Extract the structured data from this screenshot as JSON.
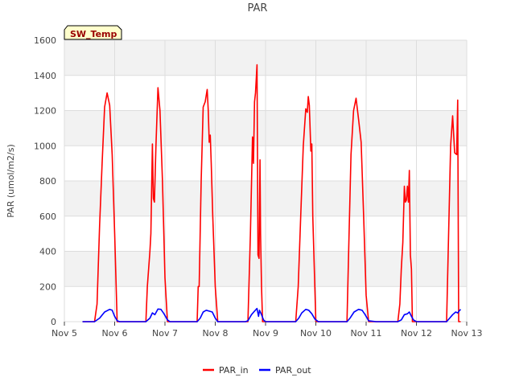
{
  "chart_data": {
    "type": "line",
    "title": "PAR",
    "xlabel": "",
    "ylabel": "PAR (umol/m2/s)",
    "badge": "SW_Temp",
    "xlim": [
      5,
      13
    ],
    "ylim": [
      0,
      1600
    ],
    "x_ticks": [
      5,
      6,
      7,
      8,
      9,
      10,
      11,
      12,
      13
    ],
    "x_tick_labels": [
      "Nov 5",
      "Nov 6",
      "Nov 7",
      "Nov 8",
      "Nov 9",
      "Nov 10",
      "Nov 11",
      "Nov 12",
      "Nov 13"
    ],
    "y_ticks": [
      0,
      200,
      400,
      600,
      800,
      1000,
      1200,
      1400,
      1600
    ],
    "y_tick_labels": [
      "0",
      "200",
      "400",
      "600",
      "800",
      "1000",
      "1200",
      "1400",
      "1600"
    ],
    "grid": true,
    "legend_position": "bottom-center",
    "series": [
      {
        "name": "PAR_in",
        "color": "#ff0000",
        "x": [
          5.36,
          5.6,
          5.65,
          5.7,
          5.75,
          5.8,
          5.85,
          5.9,
          5.95,
          6.0,
          6.05,
          6.1,
          6.15,
          6.2,
          6.25,
          6.35,
          6.62,
          6.65,
          6.7,
          6.72,
          6.75,
          6.77,
          6.79,
          6.82,
          6.86,
          6.9,
          6.95,
          7.0,
          7.05,
          7.1,
          7.15,
          7.25,
          7.64,
          7.66,
          7.68,
          7.72,
          7.76,
          7.8,
          7.84,
          7.86,
          7.88,
          7.9,
          7.92,
          7.95,
          8.0,
          8.05,
          8.1,
          8.2,
          8.6,
          8.65,
          8.7,
          8.74,
          8.76,
          8.78,
          8.8,
          8.83,
          8.85,
          8.87,
          8.89,
          8.9,
          8.92,
          8.94,
          8.96,
          9.0,
          9.05,
          9.1,
          9.2,
          9.6,
          9.65,
          9.7,
          9.75,
          9.8,
          9.83,
          9.85,
          9.87,
          9.9,
          9.92,
          9.94,
          9.97,
          10.0,
          10.05,
          10.1,
          10.2,
          10.62,
          10.66,
          10.7,
          10.75,
          10.8,
          10.85,
          10.9,
          10.95,
          11.0,
          11.05,
          11.1,
          11.15,
          11.2,
          11.63,
          11.67,
          11.7,
          11.73,
          11.76,
          11.78,
          11.8,
          11.82,
          11.84,
          11.86,
          11.88,
          11.9,
          11.92,
          11.95,
          12.0,
          12.6,
          12.64,
          12.68,
          12.72,
          12.76,
          12.8,
          12.82,
          12.84,
          12.86,
          12.88
        ],
        "y": [
          0,
          0,
          100,
          550,
          900,
          1220,
          1300,
          1230,
          950,
          500,
          0,
          0,
          0,
          0,
          0,
          0,
          0,
          200,
          400,
          500,
          1010,
          700,
          680,
          1000,
          1330,
          1200,
          800,
          250,
          0,
          0,
          0,
          0,
          0,
          200,
          200,
          800,
          1220,
          1250,
          1320,
          1200,
          1020,
          1060,
          900,
          600,
          200,
          0,
          0,
          0,
          0,
          0,
          500,
          1050,
          900,
          1250,
          1300,
          1460,
          380,
          360,
          920,
          500,
          200,
          0,
          0,
          0,
          0,
          0,
          0,
          0,
          200,
          600,
          1000,
          1210,
          1190,
          1280,
          1230,
          970,
          1010,
          600,
          300,
          0,
          0,
          0,
          0,
          0,
          500,
          950,
          1200,
          1270,
          1150,
          1020,
          600,
          150,
          0,
          0,
          0,
          0,
          0,
          100,
          300,
          450,
          770,
          680,
          690,
          770,
          680,
          860,
          380,
          300,
          0,
          0,
          0,
          0,
          500,
          1000,
          1170,
          960,
          950,
          1260,
          0,
          0,
          0
        ]
      },
      {
        "name": "PAR_out",
        "color": "#0000ff",
        "x": [
          5.36,
          5.6,
          5.7,
          5.8,
          5.9,
          5.95,
          6.0,
          6.05,
          6.1,
          6.35,
          6.62,
          6.7,
          6.75,
          6.8,
          6.86,
          6.92,
          6.98,
          7.05,
          7.1,
          7.25,
          7.64,
          7.7,
          7.76,
          7.82,
          7.88,
          7.94,
          8.0,
          8.05,
          8.2,
          8.6,
          8.65,
          8.72,
          8.78,
          8.83,
          8.86,
          8.88,
          8.92,
          8.96,
          9.0,
          9.2,
          9.6,
          9.66,
          9.72,
          9.8,
          9.86,
          9.92,
          9.98,
          10.05,
          10.2,
          10.62,
          10.68,
          10.76,
          10.85,
          10.92,
          10.98,
          11.05,
          11.2,
          11.63,
          11.7,
          11.76,
          11.82,
          11.86,
          11.9,
          11.94,
          12.0,
          12.6,
          12.66,
          12.72,
          12.78,
          12.82,
          12.86,
          12.88
        ],
        "y": [
          0,
          0,
          20,
          55,
          70,
          65,
          30,
          5,
          0,
          0,
          0,
          20,
          50,
          40,
          72,
          70,
          45,
          10,
          0,
          0,
          0,
          20,
          55,
          65,
          60,
          55,
          20,
          0,
          0,
          0,
          5,
          40,
          60,
          75,
          30,
          65,
          40,
          10,
          0,
          0,
          0,
          20,
          50,
          70,
          65,
          45,
          15,
          0,
          0,
          0,
          20,
          55,
          70,
          65,
          40,
          5,
          0,
          0,
          10,
          40,
          45,
          55,
          30,
          10,
          0,
          0,
          20,
          40,
          55,
          50,
          65,
          70
        ]
      }
    ]
  }
}
